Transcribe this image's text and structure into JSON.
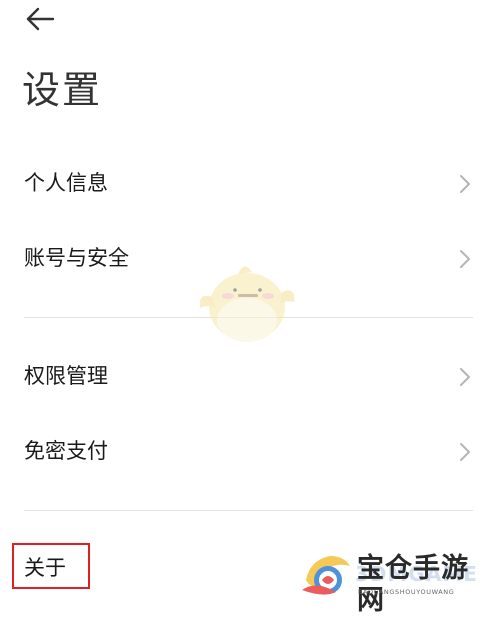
{
  "header": {
    "back_icon": "arrow-left-icon",
    "title": "设置"
  },
  "settings": {
    "group1": [
      {
        "label": "个人信息",
        "icon": "chevron-right-icon"
      },
      {
        "label": "账号与安全",
        "icon": "chevron-right-icon"
      }
    ],
    "group2": [
      {
        "label": "权限管理",
        "icon": "chevron-right-icon"
      },
      {
        "label": "免密支付",
        "icon": "chevron-right-icon"
      }
    ],
    "group3": [
      {
        "label": "关于"
      }
    ]
  },
  "watermark": {
    "title": "宝仓手游网",
    "subtitle": "BAOCANGSHOUYOUWANG",
    "overlay": "3DMGAME"
  },
  "colors": {
    "highlight": "#e02020",
    "divider": "#e2e2e2",
    "chevron": "#b5b5b5"
  }
}
